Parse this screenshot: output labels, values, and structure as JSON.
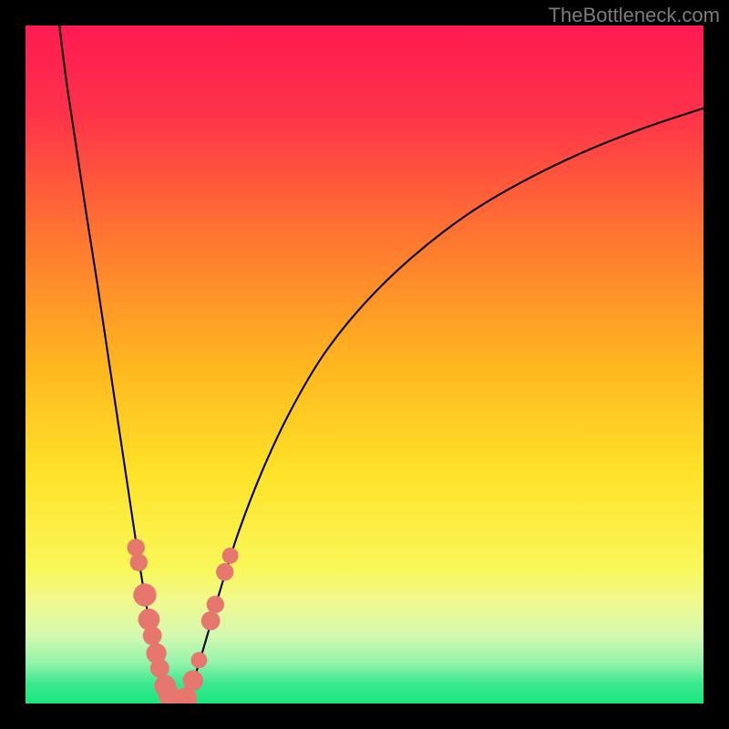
{
  "watermark": "TheBottleneck.com",
  "chart_data": {
    "type": "line",
    "title": "",
    "xlabel": "",
    "ylabel": "",
    "xlim": [
      0,
      100
    ],
    "ylim": [
      0,
      100
    ],
    "background_gradient": {
      "stops": [
        {
          "y_pct": 0,
          "color": "#ff1a52"
        },
        {
          "y_pct": 13,
          "color": "#ff324a"
        },
        {
          "y_pct": 30,
          "color": "#ff7232"
        },
        {
          "y_pct": 50,
          "color": "#ffb61f"
        },
        {
          "y_pct": 66,
          "color": "#ffe228"
        },
        {
          "y_pct": 80,
          "color": "#f9f758"
        },
        {
          "y_pct": 85,
          "color": "#f0f98e"
        },
        {
          "y_pct": 90,
          "color": "#d4f9b0"
        },
        {
          "y_pct": 94,
          "color": "#93f3ab"
        },
        {
          "y_pct": 97,
          "color": "#3de990"
        },
        {
          "y_pct": 100,
          "color": "#18e77e"
        }
      ]
    },
    "series": [
      {
        "name": "left-branch",
        "x": [
          5,
          6,
          7.5,
          9,
          10.5,
          12,
          13.5,
          15,
          16.5,
          18,
          19.5,
          20.2,
          21,
          21.6
        ],
        "y": [
          100,
          92,
          82,
          72,
          62.5,
          52.5,
          42.5,
          32.5,
          22.5,
          13.5,
          6.5,
          3.5,
          1.3,
          0.4
        ]
      },
      {
        "name": "right-branch",
        "x": [
          23.5,
          24.2,
          25.3,
          26.8,
          28.8,
          31.5,
          35,
          39,
          44,
          50,
          57,
          65,
          73,
          82,
          91,
          100
        ],
        "y": [
          0.4,
          1.8,
          5.0,
          10.0,
          17.0,
          25.5,
          34.5,
          43.0,
          51.5,
          59.0,
          65.8,
          72.0,
          76.8,
          81.2,
          84.8,
          87.8
        ]
      }
    ],
    "markers": {
      "name": "salmon-dots",
      "color": "#e7776e",
      "points": [
        {
          "x": 16.3,
          "y": 23.0,
          "r": 1.3
        },
        {
          "x": 16.7,
          "y": 20.8,
          "r": 1.3
        },
        {
          "x": 17.6,
          "y": 16.0,
          "r": 1.7
        },
        {
          "x": 18.2,
          "y": 12.4,
          "r": 1.6
        },
        {
          "x": 18.7,
          "y": 10.0,
          "r": 1.4
        },
        {
          "x": 19.3,
          "y": 7.4,
          "r": 1.5
        },
        {
          "x": 19.8,
          "y": 5.2,
          "r": 1.4
        },
        {
          "x": 20.6,
          "y": 2.6,
          "r": 1.6
        },
        {
          "x": 21.2,
          "y": 1.2,
          "r": 1.6
        },
        {
          "x": 22.6,
          "y": 0.4,
          "r": 1.7
        },
        {
          "x": 23.7,
          "y": 0.8,
          "r": 1.6
        },
        {
          "x": 24.7,
          "y": 3.4,
          "r": 1.5
        },
        {
          "x": 25.6,
          "y": 6.4,
          "r": 1.2
        },
        {
          "x": 27.3,
          "y": 12.2,
          "r": 1.4
        },
        {
          "x": 28.0,
          "y": 14.6,
          "r": 1.3
        },
        {
          "x": 29.4,
          "y": 19.4,
          "r": 1.3
        },
        {
          "x": 30.2,
          "y": 21.8,
          "r": 1.2
        }
      ]
    }
  }
}
